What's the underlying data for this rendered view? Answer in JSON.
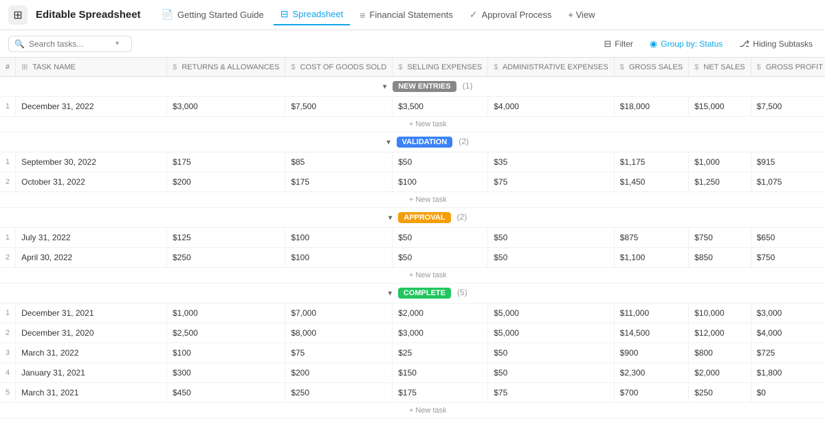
{
  "app": {
    "logo": "⊞",
    "title": "Editable Spreadsheet"
  },
  "nav": {
    "tabs": [
      {
        "id": "getting-started",
        "label": "Getting Started Guide",
        "icon": "📄",
        "active": false
      },
      {
        "id": "spreadsheet",
        "label": "Spreadsheet",
        "icon": "📊",
        "active": true
      },
      {
        "id": "financial-statements",
        "label": "Financial Statements",
        "icon": "≡",
        "active": false
      },
      {
        "id": "approval-process",
        "label": "Approval Process",
        "icon": "✓",
        "active": false
      }
    ],
    "add_view": "+ View"
  },
  "toolbar": {
    "search_placeholder": "Search tasks...",
    "filter_label": "Filter",
    "group_by_label": "Group by: Status",
    "hiding_subtasks_label": "Hiding Subtasks"
  },
  "columns": [
    {
      "id": "num",
      "label": "#"
    },
    {
      "id": "task_name",
      "label": "TASK NAME",
      "icon": "⊞"
    },
    {
      "id": "returns",
      "label": "RETURNS & ALLOWANCES",
      "icon": "$"
    },
    {
      "id": "cogs",
      "label": "COST OF GOODS SOLD",
      "icon": "$"
    },
    {
      "id": "selling",
      "label": "SELLING EXPENSES",
      "icon": "$"
    },
    {
      "id": "admin",
      "label": "ADMINISTRATIVE EXPENSES",
      "icon": "$"
    },
    {
      "id": "gross_sales",
      "label": "GROSS SALES",
      "icon": "$"
    },
    {
      "id": "net_sales",
      "label": "NET SALES",
      "icon": "$"
    },
    {
      "id": "gross_profit",
      "label": "GROSS PROFIT (LOSS)",
      "icon": "$"
    }
  ],
  "groups": [
    {
      "id": "new-entries",
      "label": "NEW ENTRIES",
      "badge_class": "badge-new-entries",
      "count": 1,
      "rows": [
        {
          "num": 1,
          "task": "December 31, 2022",
          "returns": "$3,000",
          "cogs": "$7,500",
          "selling": "$3,500",
          "admin": "$4,000",
          "gross_sales": "$18,000",
          "net_sales": "$15,000",
          "gross_profit": "$7,500"
        }
      ]
    },
    {
      "id": "validation",
      "label": "VALIDATION",
      "badge_class": "badge-validation",
      "count": 2,
      "rows": [
        {
          "num": 1,
          "task": "September 30, 2022",
          "returns": "$175",
          "cogs": "$85",
          "selling": "$50",
          "admin": "$35",
          "gross_sales": "$1,175",
          "net_sales": "$1,000",
          "gross_profit": "$915"
        },
        {
          "num": 2,
          "task": "October 31, 2022",
          "returns": "$200",
          "cogs": "$175",
          "selling": "$100",
          "admin": "$75",
          "gross_sales": "$1,450",
          "net_sales": "$1,250",
          "gross_profit": "$1,075"
        }
      ]
    },
    {
      "id": "approval",
      "label": "APPROVAL",
      "badge_class": "badge-approval",
      "count": 2,
      "rows": [
        {
          "num": 1,
          "task": "July 31, 2022",
          "returns": "$125",
          "cogs": "$100",
          "selling": "$50",
          "admin": "$50",
          "gross_sales": "$875",
          "net_sales": "$750",
          "gross_profit": "$650"
        },
        {
          "num": 2,
          "task": "April 30, 2022",
          "returns": "$250",
          "cogs": "$100",
          "selling": "$50",
          "admin": "$50",
          "gross_sales": "$1,100",
          "net_sales": "$850",
          "gross_profit": "$750"
        }
      ]
    },
    {
      "id": "complete",
      "label": "COMPLETE",
      "badge_class": "badge-complete",
      "count": 5,
      "rows": [
        {
          "num": 1,
          "task": "December 31, 2021",
          "returns": "$1,000",
          "cogs": "$7,000",
          "selling": "$2,000",
          "admin": "$5,000",
          "gross_sales": "$11,000",
          "net_sales": "$10,000",
          "gross_profit": "$3,000"
        },
        {
          "num": 2,
          "task": "December 31, 2020",
          "returns": "$2,500",
          "cogs": "$8,000",
          "selling": "$3,000",
          "admin": "$5,000",
          "gross_sales": "$14,500",
          "net_sales": "$12,000",
          "gross_profit": "$4,000"
        },
        {
          "num": 3,
          "task": "March 31, 2022",
          "returns": "$100",
          "cogs": "$75",
          "selling": "$25",
          "admin": "$50",
          "gross_sales": "$900",
          "net_sales": "$800",
          "gross_profit": "$725"
        },
        {
          "num": 4,
          "task": "January 31, 2021",
          "returns": "$300",
          "cogs": "$200",
          "selling": "$150",
          "admin": "$50",
          "gross_sales": "$2,300",
          "net_sales": "$2,000",
          "gross_profit": "$1,800"
        },
        {
          "num": 5,
          "task": "March 31, 2021",
          "returns": "$450",
          "cogs": "$250",
          "selling": "$175",
          "admin": "$75",
          "gross_sales": "$700",
          "net_sales": "$250",
          "gross_profit": "$0"
        }
      ]
    }
  ],
  "new_task_label": "+ New task"
}
